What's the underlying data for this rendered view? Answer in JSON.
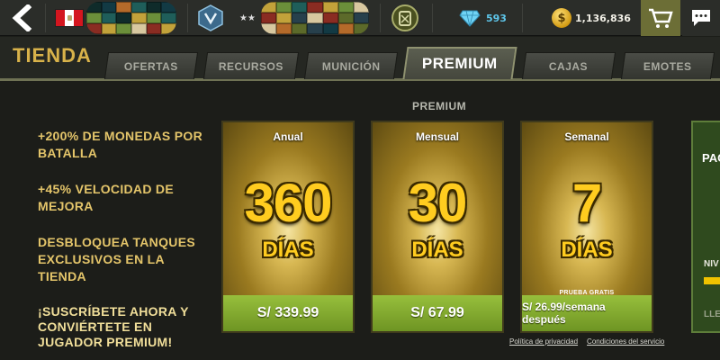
{
  "topbar": {
    "gems": "593",
    "coins": "1,136,836",
    "coin_symbol": "$",
    "rank_stars": "★★"
  },
  "store": {
    "title": "TIENDA",
    "tabs": [
      {
        "label": "OFERTAS",
        "active": false
      },
      {
        "label": "RECURSOS",
        "active": false
      },
      {
        "label": "MUNICIÓN",
        "active": false
      },
      {
        "label": "PREMIUM",
        "active": true
      },
      {
        "label": "CAJAS",
        "active": false
      },
      {
        "label": "EMOTES",
        "active": false
      }
    ],
    "section_label": "PREMIUM"
  },
  "benefits": [
    "+200% DE MONEDAS POR BATALLA",
    "+45% VELOCIDAD DE MEJORA",
    "DESBLOQUEA TANQUES EXCLUSIVOS EN LA TIENDA",
    "¡SUSCRÍBETE AHORA Y CONVIÉRTETE EN JUGADOR PREMIUM!"
  ],
  "plans": [
    {
      "name": "Anual",
      "number": "360",
      "unit": "DÍAS",
      "trial": "",
      "price": "S/ 339.99"
    },
    {
      "name": "Mensual",
      "number": "30",
      "unit": "DÍAS",
      "trial": "",
      "price": "S/ 67.99"
    },
    {
      "name": "Semanal",
      "number": "7",
      "unit": "DÍAS",
      "trial": "PRUEBA GRATIS",
      "price": "S/ 26.99/semana después"
    }
  ],
  "partial_card": {
    "title": "PAC",
    "level": "NIV",
    "footer": "LLEI"
  },
  "footer_links": {
    "privacy": "Política de privacidad",
    "terms": "Condiciones del servicio"
  },
  "colors": {
    "accent_gold": "#d8b24a",
    "price_green": "#8ab535",
    "gem_blue": "#5ec6ea",
    "flag_red": "#d4161f"
  }
}
